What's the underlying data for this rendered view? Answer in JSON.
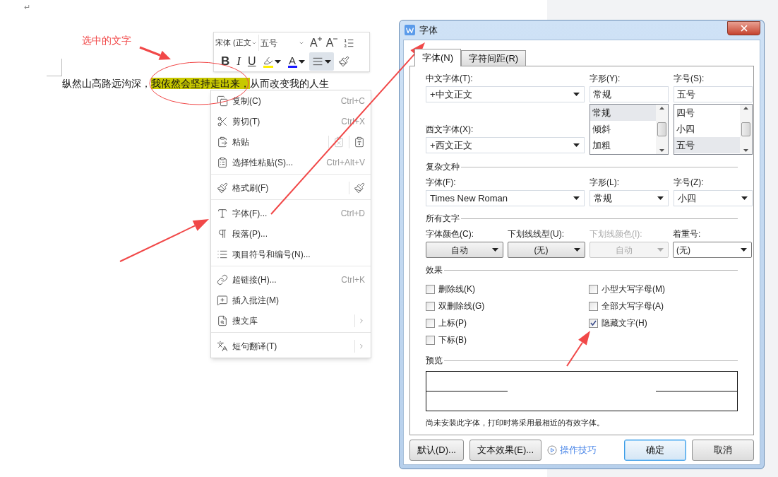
{
  "document": {
    "paragraph_mark": "↵",
    "paragraph": [
      {
        "text": "纵然山高路远沟深，",
        "highlighted": false
      },
      {
        "text": "我依然会坚持走出来，",
        "highlighted": true
      },
      {
        "text": "从而改变我的人生",
        "highlighted": false
      }
    ]
  },
  "annotation": {
    "label": "选中的文字"
  },
  "mini_toolbar": {
    "font": "宋体 (正文",
    "size": "五号",
    "grow": "A",
    "shrink": "A",
    "buttons": [
      {
        "kind": "bold",
        "label": "B",
        "selected": false
      },
      {
        "kind": "italic",
        "label": "I",
        "selected": false
      },
      {
        "kind": "underline",
        "label": "U",
        "selected": false
      },
      {
        "kind": "highlight",
        "selected": false
      },
      {
        "kind": "color",
        "label": "A",
        "selected": false
      },
      {
        "kind": "align",
        "selected": true
      },
      {
        "kind": "painter",
        "selected": false
      }
    ]
  },
  "context_menu": {
    "groups": [
      [
        {
          "label": "复制(C)",
          "shortcut": "Ctrl+C",
          "kind": "plain",
          "submenu": false
        },
        {
          "label": "剪切(T)",
          "shortcut": "Ctrl+X",
          "kind": "plain",
          "submenu": false
        },
        {
          "label": "粘贴",
          "kind": "paste-options",
          "submenu": false
        },
        {
          "label": "选择性粘贴(S)...",
          "shortcut": "Ctrl+Alt+V",
          "kind": "plain",
          "submenu": false
        }
      ],
      [
        {
          "label": "格式刷(F)",
          "kind": "painter",
          "submenu": false
        }
      ],
      [
        {
          "label": "字体(F)...",
          "shortcut": "Ctrl+D",
          "kind": "plain",
          "submenu": false
        },
        {
          "label": "段落(P)...",
          "kind": "plain",
          "submenu": false
        },
        {
          "label": "项目符号和编号(N)...",
          "kind": "plain",
          "submenu": false
        }
      ],
      [
        {
          "label": "超链接(H)...",
          "shortcut": "Ctrl+K",
          "kind": "plain",
          "submenu": false
        },
        {
          "label": "插入批注(M)",
          "kind": "plain",
          "submenu": false
        },
        {
          "label": "搜文库",
          "kind": "plain",
          "submenu": true
        }
      ],
      [
        {
          "label": "短句翻译(T)",
          "kind": "plain",
          "submenu": true
        }
      ]
    ]
  },
  "dialog": {
    "title": "字体",
    "tabs": [
      {
        "label": "字体(N)",
        "selected": true
      },
      {
        "label": "字符间距(R)",
        "selected": false
      }
    ],
    "chinese_font": {
      "label": "中文字体(T):",
      "value": "+中文正文"
    },
    "western_font": {
      "label": "西文字体(X):",
      "value": "+西文正文"
    },
    "style": {
      "label": "字形(Y):",
      "value": "常规",
      "options": [
        {
          "label": "常规",
          "selected": true
        },
        {
          "label": "倾斜",
          "selected": false
        },
        {
          "label": "加粗",
          "selected": false
        }
      ]
    },
    "size": {
      "label": "字号(S):",
      "value": "五号",
      "options": [
        {
          "label": "四号",
          "selected": false
        },
        {
          "label": "小四",
          "selected": false
        },
        {
          "label": "五号",
          "selected": true
        }
      ]
    },
    "complex_script": {
      "heading": "复杂文种",
      "fields": [
        {
          "label": "字体(F):",
          "value": "Times New Roman"
        },
        {
          "label": "字形(L):",
          "value": "常规"
        },
        {
          "label": "字号(Z):",
          "value": "小四"
        }
      ]
    },
    "all_text": {
      "heading": "所有文字",
      "fields": [
        {
          "label": "字体颜色(C):",
          "value": "自动",
          "kind": "button",
          "disabled": false
        },
        {
          "label": "下划线线型(U):",
          "value": "(无)",
          "kind": "button",
          "disabled": false
        },
        {
          "label": "下划线颜色(I):",
          "value": "自动",
          "kind": "button",
          "disabled": true
        },
        {
          "label": "着重号:",
          "value": "(无)",
          "kind": "combo",
          "disabled": false
        }
      ]
    },
    "effects": {
      "heading": "效果",
      "items": [
        {
          "label": "删除线(K)",
          "checked": false
        },
        {
          "label": "小型大写字母(M)",
          "checked": false
        },
        {
          "label": "双删除线(G)",
          "checked": false
        },
        {
          "label": "全部大写字母(A)",
          "checked": false
        },
        {
          "label": "上标(P)",
          "checked": false
        },
        {
          "label": "隐藏文字(H)",
          "checked": true
        },
        {
          "label": "下标(B)",
          "checked": false
        }
      ]
    },
    "preview": {
      "heading": "预览",
      "note": "尚未安装此字体，打印时将采用最相近的有效字体。"
    },
    "buttons": [
      {
        "label": "默认(D)...",
        "kind": "button",
        "focused": false
      },
      {
        "label": "文本效果(E)...",
        "kind": "button",
        "focused": false
      },
      {
        "label": "操作技巧",
        "kind": "link"
      },
      {
        "label": "确定",
        "kind": "button",
        "focused": true
      },
      {
        "label": "取消",
        "kind": "button",
        "focused": false
      }
    ]
  }
}
